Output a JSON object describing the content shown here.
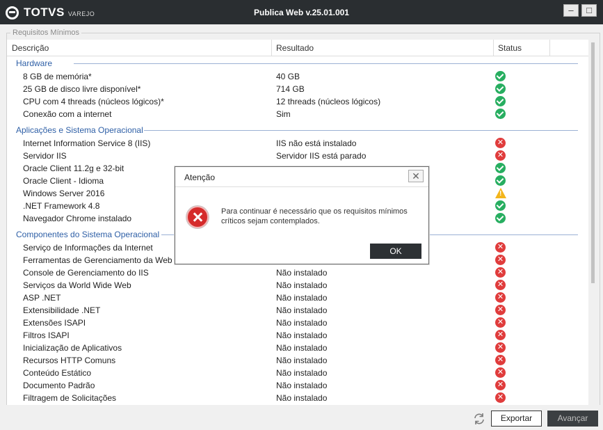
{
  "window": {
    "brand": "TOTVS",
    "brand_sub": "VAREJO",
    "title": "Publica Web v.25.01.001",
    "minimize_glyph": "–",
    "maximize_glyph": "□"
  },
  "group_title": "Requisitos Mínimos",
  "columns": {
    "description": "Descrição",
    "result": "Resultado",
    "status": "Status"
  },
  "groups": [
    {
      "title": "Hardware"
    },
    {
      "title": "Aplicações e Sistema Operacional"
    },
    {
      "title": "Componentes do Sistema Operacional"
    }
  ],
  "rows": [
    {
      "desc": "8 GB de memória*",
      "result": "40 GB",
      "status": "ok"
    },
    {
      "desc": "25 GB de disco livre disponível*",
      "result": "714 GB",
      "status": "ok"
    },
    {
      "desc": "CPU com 4 threads (núcleos lógicos)*",
      "result": "12 threads (núcleos lógicos)",
      "status": "ok"
    },
    {
      "desc": "Conexão com a internet",
      "result": "Sim",
      "status": "ok"
    },
    {
      "desc": "Internet Information Service 8 (IIS)",
      "result": "IIS não está instalado",
      "status": "error"
    },
    {
      "desc": "Servidor IIS",
      "result": "Servidor IIS está parado",
      "status": "error"
    },
    {
      "desc": "Oracle Client 11.2g e 32-bit",
      "result": "",
      "status": "ok"
    },
    {
      "desc": "Oracle Client - Idioma",
      "result": "",
      "status": "ok"
    },
    {
      "desc": "Windows Server 2016",
      "result": "",
      "status": "warning"
    },
    {
      "desc": ".NET Framework 4.8",
      "result": "",
      "status": "ok"
    },
    {
      "desc": "Navegador Chrome instalado",
      "result": "",
      "status": "ok"
    },
    {
      "desc": "Serviço de Informações da Internet",
      "result": "",
      "status": "error"
    },
    {
      "desc": "Ferramentas de Gerenciamento da Web",
      "result": "",
      "status": "error"
    },
    {
      "desc": "Console de Gerenciamento do IIS",
      "result": "Não instalado",
      "status": "error"
    },
    {
      "desc": "Serviços da World Wide Web",
      "result": "Não instalado",
      "status": "error"
    },
    {
      "desc": "ASP .NET",
      "result": "Não instalado",
      "status": "error"
    },
    {
      "desc": "Extensibilidade .NET",
      "result": "Não instalado",
      "status": "error"
    },
    {
      "desc": "Extensões ISAPI",
      "result": "Não instalado",
      "status": "error"
    },
    {
      "desc": "Filtros ISAPI",
      "result": "Não instalado",
      "status": "error"
    },
    {
      "desc": "Inicialização de Aplicativos",
      "result": "Não instalado",
      "status": "error"
    },
    {
      "desc": "Recursos HTTP Comuns",
      "result": "Não instalado",
      "status": "error"
    },
    {
      "desc": "Conteúdo Estático",
      "result": "Não instalado",
      "status": "error"
    },
    {
      "desc": "Documento Padrão",
      "result": "Não instalado",
      "status": "error"
    },
    {
      "desc": "Filtragem de Solicitações",
      "result": "Não instalado",
      "status": "error"
    }
  ],
  "footer": {
    "export_label": "Exportar",
    "next_label": "Avançar"
  },
  "dialog": {
    "title": "Atenção",
    "close_glyph": "✕",
    "message": "Para continuar é necessário que os requisitos mínimos críticos sejam contemplados.",
    "ok_label": "OK"
  },
  "colors": {
    "titlebar": "#2a2e31",
    "group_heading": "#2e5fa6",
    "status_ok": "#27ae60",
    "status_error": "#e03c3c",
    "status_warning": "#f3b51b"
  }
}
